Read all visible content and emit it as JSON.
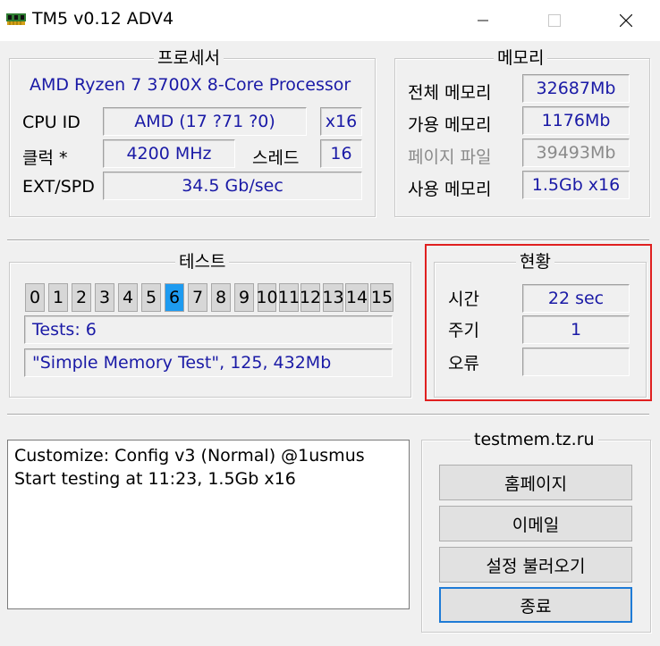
{
  "window": {
    "title": "TM5 v0.12 ADV4",
    "icons": {
      "app": "memory-chip-icon",
      "minimize": "minimize-icon",
      "maximize": "maximize-icon",
      "close": "close-icon"
    }
  },
  "processor": {
    "group_title": "프로세서",
    "cpu_name": "AMD Ryzen 7 3700X 8-Core Processor",
    "cpu_id_label": "CPU ID",
    "cpu_id_value": "AMD  (17 ?71 ?0)",
    "cpu_id_mult": "x16",
    "clock_label": "클럭 *",
    "clock_value": "4200 MHz",
    "threads_label": "스레드",
    "threads_value": "16",
    "ext_label": "EXT/SPD",
    "ext_value": "34.5 Gb/sec"
  },
  "memory": {
    "group_title": "메모리",
    "total_label": "전체 메모리",
    "total_value": "32687Mb",
    "available_label": "가용 메모리",
    "available_value": "1176Mb",
    "page_label": "페이지 파일",
    "page_value": "39493Mb",
    "used_label": "사용 메모리",
    "used_value": "1.5Gb x16"
  },
  "test": {
    "group_title": "테스트",
    "numbers": [
      "0",
      "1",
      "2",
      "3",
      "4",
      "5",
      "6",
      "7",
      "8",
      "9",
      "10",
      "11",
      "12",
      "13",
      "14",
      "15"
    ],
    "active_index": 6,
    "tests_line": "Tests: 6",
    "current_line": "\"Simple Memory Test\", 125, 432Mb"
  },
  "status": {
    "group_title": "현황",
    "time_label": "시간",
    "time_value": "22 sec",
    "cycle_label": "주기",
    "cycle_value": "1",
    "error_label": "오류",
    "error_value": ""
  },
  "log": {
    "lines": [
      "Customize: Config v3 (Normal) @1usmus",
      "Start testing at 11:23, 1.5Gb x16"
    ]
  },
  "links": {
    "group_title": "testmem.tz.ru",
    "homepage_label": "홈페이지",
    "email_label": "이메일",
    "load_settings_label": "설정 불러오기",
    "exit_label": "종료"
  },
  "colors": {
    "value_text": "#1a1aa6",
    "active_test": "#1e9bf0",
    "highlight": "#e02020",
    "focus_border": "#1e7bd6"
  }
}
